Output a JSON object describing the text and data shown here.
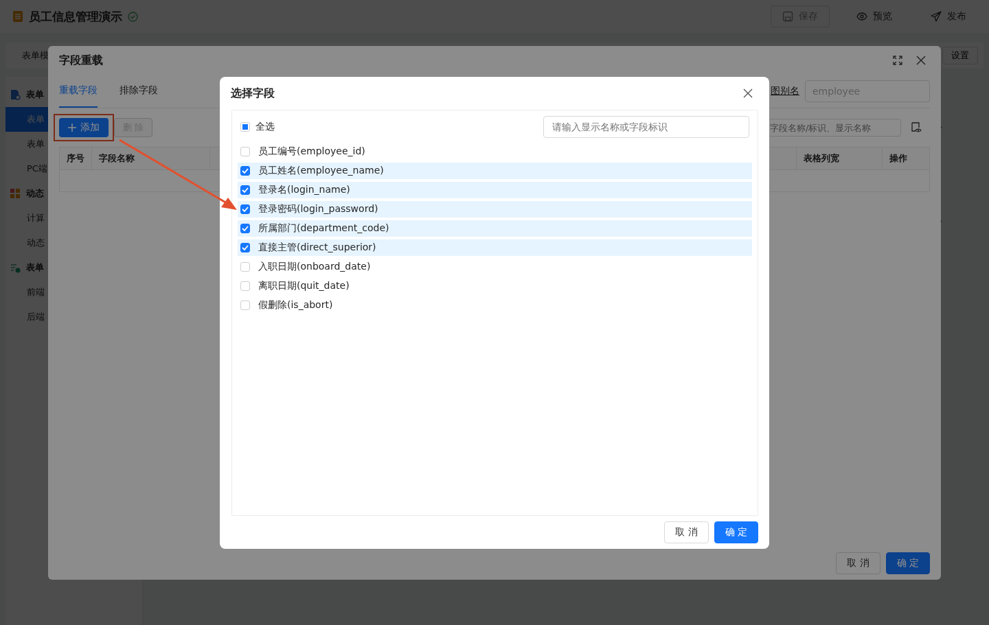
{
  "app_bar": {
    "title": "员工信息管理演示",
    "saved": true,
    "actions": [
      {
        "kind": "save",
        "label": "保存",
        "disabled": true
      },
      {
        "kind": "preview",
        "label": "预览",
        "disabled": false
      },
      {
        "kind": "publish",
        "label": "发布",
        "disabled": false
      }
    ]
  },
  "page_header": {
    "title": "表单模",
    "settings_button": "设置"
  },
  "sidebar": {
    "groups": [
      {
        "title": "表单",
        "items": [
          {
            "label": "表单",
            "selected": true
          },
          {
            "label": "表单",
            "selected": false
          },
          {
            "label": "PC端",
            "selected": false
          }
        ]
      },
      {
        "title": "动态",
        "items": [
          {
            "label": "计算",
            "selected": false
          },
          {
            "label": "动态",
            "selected": false
          }
        ]
      },
      {
        "title": "表单",
        "items": [
          {
            "label": "前端",
            "selected": false
          },
          {
            "label": "后端",
            "selected": false
          }
        ]
      }
    ]
  },
  "override_dialog": {
    "title": "字段重载",
    "tabs": [
      {
        "label": "重载字段",
        "selected": true
      },
      {
        "label": "排除字段",
        "selected": false
      }
    ],
    "alias": {
      "label": "图别名",
      "value": "employee"
    },
    "toolbar": [
      {
        "kind": "add",
        "label": "添加",
        "disabled": false,
        "highlighted": true
      },
      {
        "kind": "delete",
        "label": "删 除",
        "disabled": true,
        "highlighted": false
      }
    ],
    "search": {
      "placeholder": "字段名称/标识、显示名称"
    },
    "table": {
      "columns": [
        "序号",
        "字段名称",
        "",
        "表格列宽",
        "操作"
      ]
    },
    "buttons": [
      {
        "label": "取 消",
        "primary": false
      },
      {
        "label": "确 定",
        "primary": true
      }
    ]
  },
  "select_dialog": {
    "title": "选择字段",
    "select_all": {
      "label": "全选",
      "checked": false,
      "indeterminate": true
    },
    "search": {
      "placeholder": "请输入显示名称或字段标识"
    },
    "fields": [
      {
        "label": "员工编号(employee_id)",
        "checked": false
      },
      {
        "label": "员工姓名(employee_name)",
        "checked": true
      },
      {
        "label": "登录名(login_name)",
        "checked": true
      },
      {
        "label": "登录密码(login_password)",
        "checked": true
      },
      {
        "label": "所属部门(department_code)",
        "checked": true
      },
      {
        "label": "直接主管(direct_superior)",
        "checked": true
      },
      {
        "label": "入职日期(onboard_date)",
        "checked": false
      },
      {
        "label": "离职日期(quit_date)",
        "checked": false
      },
      {
        "label": "假删除(is_abort)",
        "checked": false
      }
    ],
    "buttons": [
      {
        "label": "取 消",
        "primary": false
      },
      {
        "label": "确 定",
        "primary": true
      }
    ]
  }
}
